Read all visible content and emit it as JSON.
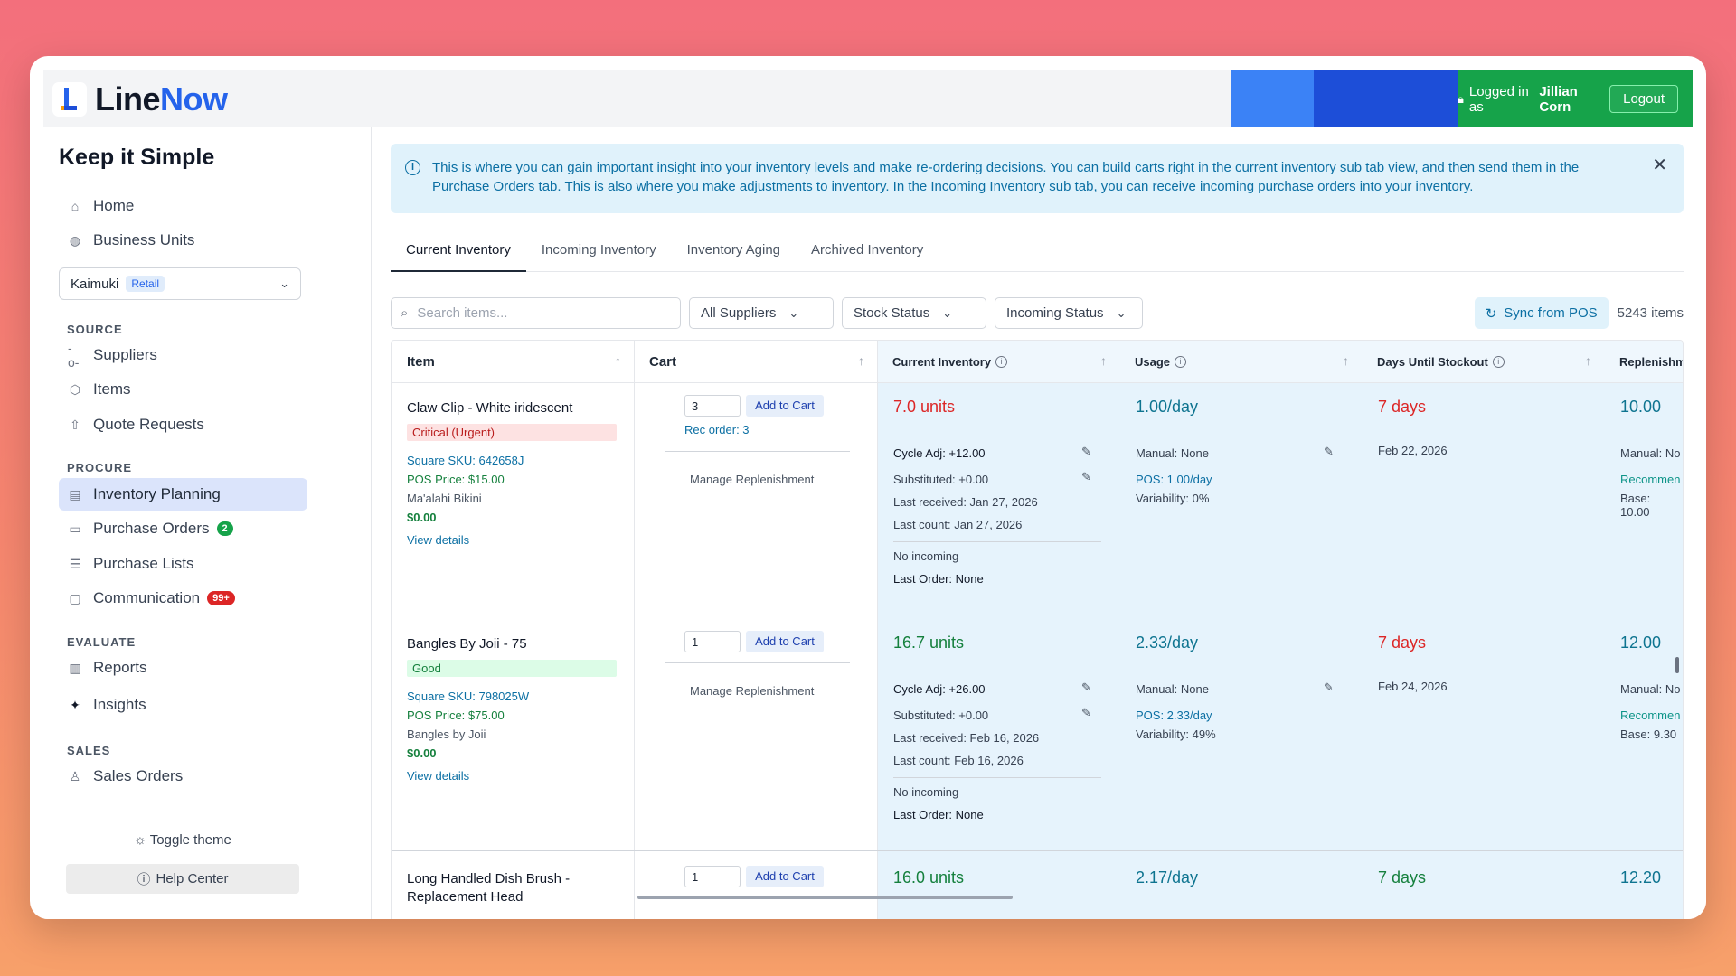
{
  "app": {
    "logo_line": "Line",
    "logo_now": "Now",
    "logged_in_prefix": "Logged in as",
    "user": "Jillian Corn",
    "logout": "Logout",
    "brand_blue": "#2563eb",
    "brand_green": "#16a34a"
  },
  "sidebar": {
    "tagline": "Keep it Simple",
    "home": "Home",
    "business_units": "Business Units",
    "bu_name": "Kaimuki",
    "bu_tag": "Retail",
    "source": "SOURCE",
    "suppliers": "Suppliers",
    "items": "Items",
    "quote_requests": "Quote Requests",
    "procure": "PROCURE",
    "inventory_planning": "Inventory Planning",
    "purchase_orders": "Purchase Orders",
    "po_badge": "2",
    "purchase_lists": "Purchase Lists",
    "communication": "Communication",
    "comm_badge": "99+",
    "evaluate": "EVALUATE",
    "reports": "Reports",
    "insights": "Insights",
    "sales": "SALES",
    "sales_orders": "Sales Orders",
    "toggle_theme": "Toggle theme",
    "help_center": "Help Center"
  },
  "info": "This is where you can gain important insight into your inventory levels and make re-ordering decisions. You can build carts right in the current inventory sub tab view, and then send them in the Purchase Orders tab. This is also where you make adjustments to inventory. In the Incoming Inventory sub tab, you can receive incoming purchase orders into your inventory.",
  "tabs": [
    "Current Inventory",
    "Incoming Inventory",
    "Inventory Aging",
    "Archived Inventory"
  ],
  "filters": {
    "search_placeholder": "Search items...",
    "suppliers": "All Suppliers",
    "stock": "Stock Status",
    "incoming": "Incoming Status",
    "sync": "Sync from POS",
    "count": "5243 items"
  },
  "columns": [
    "Item",
    "Cart",
    "Current Inventory",
    "Usage",
    "Days Until Stockout",
    "Replenishm"
  ],
  "rows": [
    {
      "name": "Claw Clip - White iridescent",
      "status": "Critical (Urgent)",
      "sku": "Square SKU: 642658J",
      "pos_price": "POS Price: $15.00",
      "supplier": "Ma'alahi Bikini",
      "cost": "$0.00",
      "view": "View details",
      "qty": "3",
      "add": "Add to Cart",
      "rec": "Rec order: 3",
      "manage": "Manage Replenishment",
      "inv": "7.0 units",
      "cycle": "Cycle Adj: +12.00",
      "subst": "Substituted: +0.00",
      "last_recv": "Last received: Jan 27, 2026",
      "last_count": "Last count: Jan 27, 2026",
      "no_incoming": "No incoming",
      "last_order": "Last Order: None",
      "usage": "1.00/day",
      "manual": "Manual: None",
      "pos_usage": "POS: 1.00/day",
      "variability": "Variability: 0%",
      "days": "7 days",
      "date": "Feb 22, 2026",
      "rep": "10.00",
      "rep_manual": "Manual: No",
      "rep_rec": "Recommen",
      "rep_base": "Base: 10.00"
    },
    {
      "name": "Bangles By Joii - 75",
      "status": "Good",
      "sku": "Square SKU: 798025W",
      "pos_price": "POS Price: $75.00",
      "supplier": "Bangles by Joii",
      "cost": "$0.00",
      "view": "View details",
      "qty": "1",
      "add": "Add to Cart",
      "manage": "Manage Replenishment",
      "inv": "16.7 units",
      "cycle": "Cycle Adj: +26.00",
      "subst": "Substituted: +0.00",
      "last_recv": "Last received: Feb 16, 2026",
      "last_count": "Last count: Feb 16, 2026",
      "no_incoming": "No incoming",
      "last_order": "Last Order: None",
      "usage": "2.33/day",
      "manual": "Manual: None",
      "pos_usage": "POS: 2.33/day",
      "variability": "Variability: 49%",
      "days": "7 days",
      "date": "Feb 24, 2026",
      "rep": "12.00",
      "rep_manual": "Manual: No",
      "rep_rec": "Recommen",
      "rep_base": "Base: 9.30"
    },
    {
      "name1": "Long Handled Dish Brush -",
      "name2": "Replacement Head",
      "qty": "1",
      "add": "Add to Cart",
      "inv": "16.0 units",
      "usage": "2.17/day",
      "days": "7 days",
      "rep": "12.20"
    }
  ]
}
